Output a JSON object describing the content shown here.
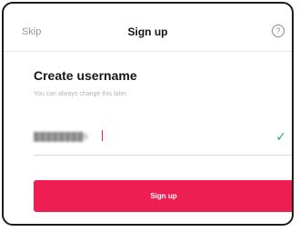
{
  "header": {
    "skip_label": "Skip",
    "title": "Sign up",
    "help_icon": "help-icon",
    "help_symbol": "?"
  },
  "main": {
    "heading": "Create username",
    "subtext": "You can always change this later.",
    "username_value": "████████6",
    "valid_icon": "checkmark-icon",
    "valid_symbol": "✓",
    "signup_label": "Sign up"
  },
  "colors": {
    "accent": "#ee1d52",
    "valid": "#25b35d",
    "muted_text": "#b3b3b3"
  }
}
